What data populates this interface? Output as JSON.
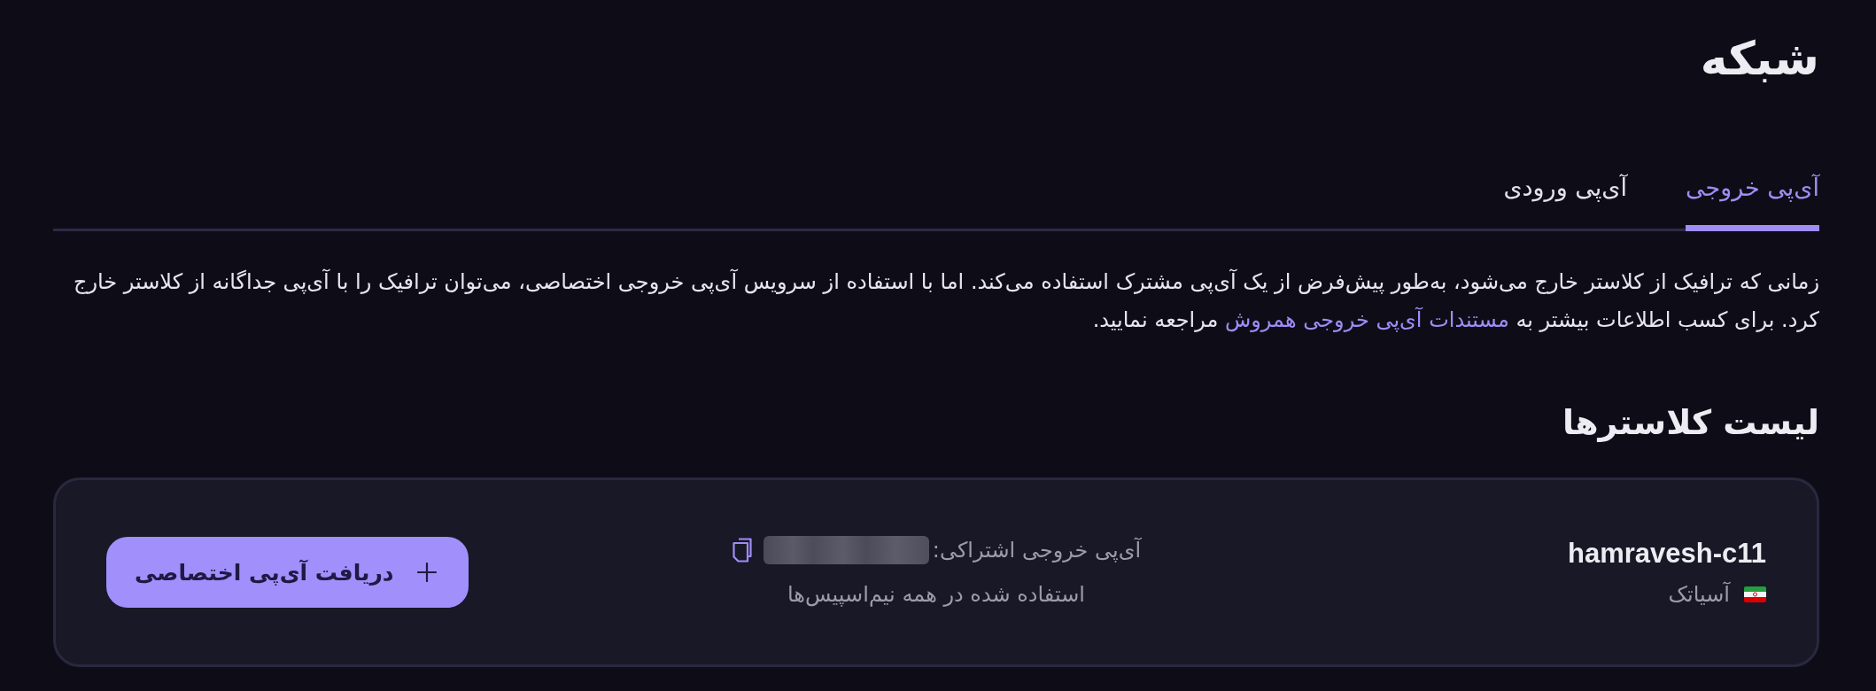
{
  "page": {
    "title": "شبکه"
  },
  "tabs": [
    {
      "label": "آی‌پی خروجی",
      "selected": true
    },
    {
      "label": "آی‌پی ورودی",
      "selected": false
    }
  ],
  "description": {
    "text_before": "زمانی که ترافیک از کلاستر خارج می‌شود، به‌طور پیش‌فرض از یک آی‌پی مشترک استفاده می‌کند. اما با استفاده از سرویس آی‌پی خروجی اختصاصی، می‌توان ترافیک را با آی‌پی جداگانه از کلاستر خارج کرد. برای کسب اطلاعات بیشتر به",
    "link": "مستندات آی‌پی خروجی همروش",
    "text_after": "مراجعه نمایید."
  },
  "clusters_section": {
    "heading": "لیست کلاسترها",
    "clusters": [
      {
        "name": "hamravesh-c11",
        "provider": "آسیاتک",
        "shared_ip_label": "آی‌پی خروجی اشتراکی:",
        "shared_ip_note": "استفاده شده در همه نیم‌اسپیس‌ها",
        "action": "دریافت آی‌پی اختصاصی"
      }
    ]
  }
}
